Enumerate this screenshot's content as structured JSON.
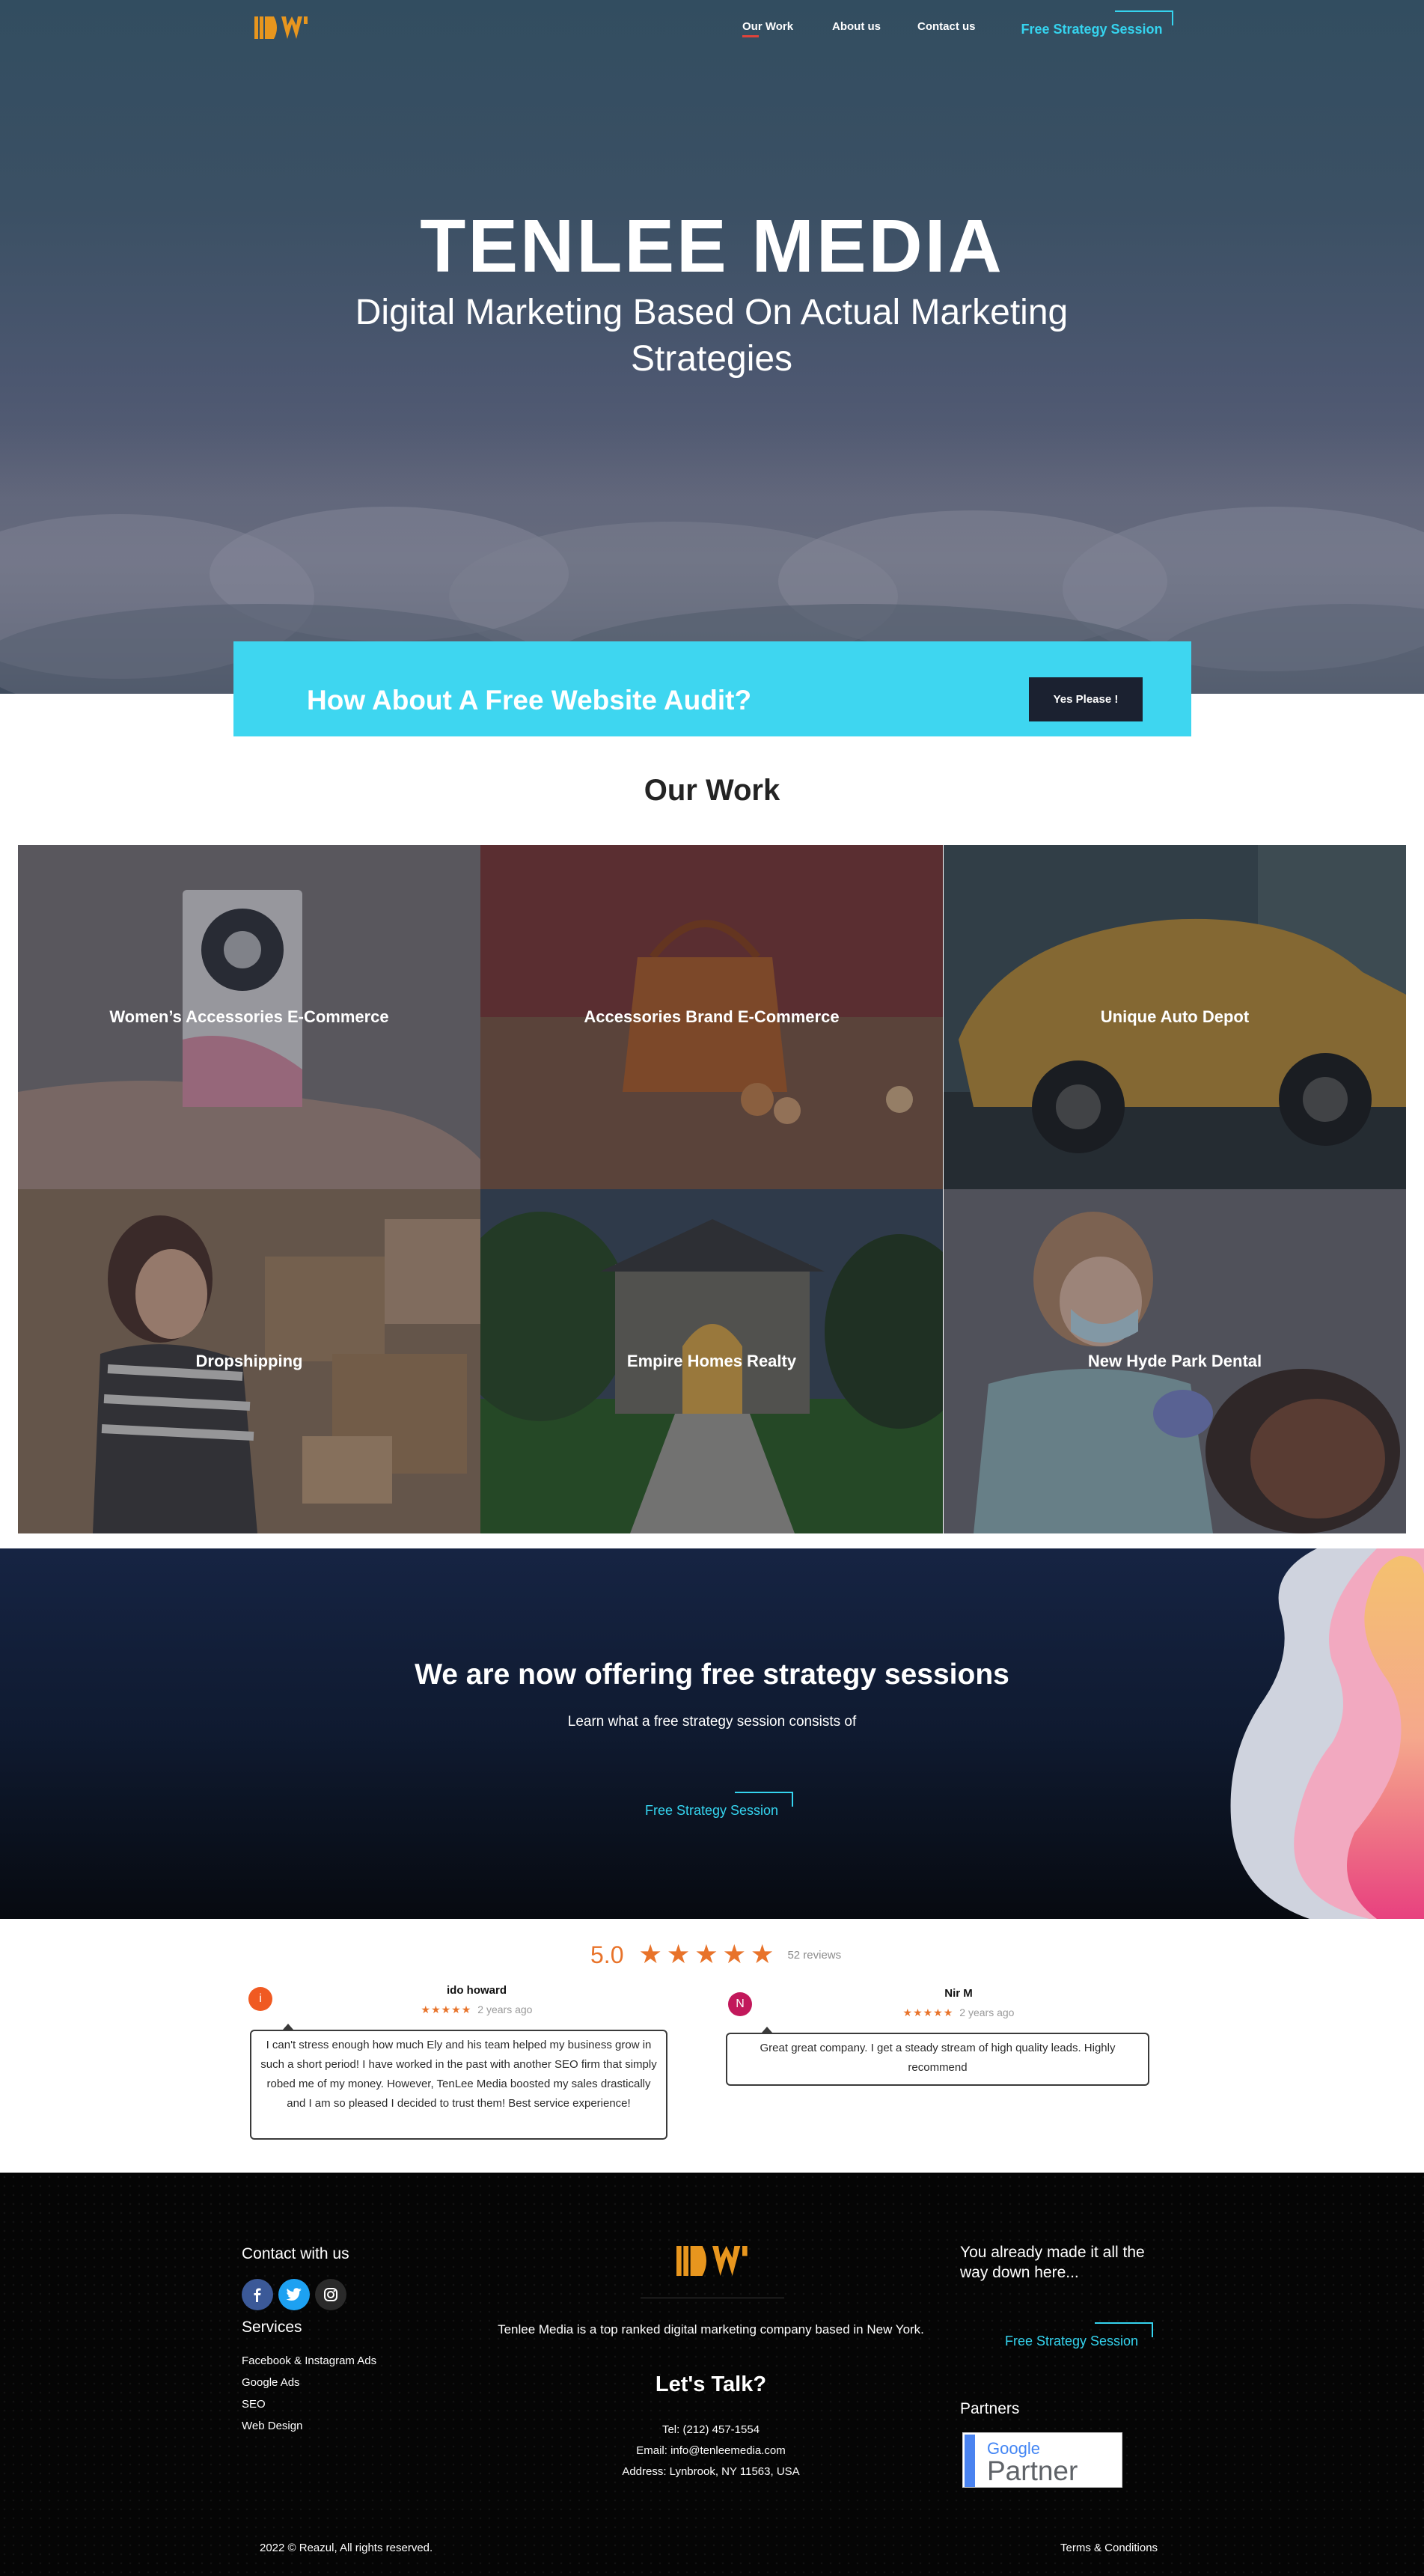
{
  "nav": {
    "links": [
      "Our Work",
      "About us",
      "Contact us"
    ],
    "cta": "Free Strategy Session"
  },
  "hero": {
    "title": "TENLEE MEDIA",
    "subtitle": "Digital Marketing Based On Actual Marketing Strategies"
  },
  "audit": {
    "title": "How About A Free Website Audit?",
    "button": "Yes Please !"
  },
  "work": {
    "title": "Our Work",
    "items": [
      "Women’s Accessories E-Commerce",
      "Accessories Brand E-Commerce",
      "Unique Auto Depot",
      "Dropshipping",
      "Empire Homes Realty",
      "New Hyde Park Dental"
    ]
  },
  "strategy": {
    "title": "We are now offering free strategy sessions",
    "subtitle": "Learn what a free strategy session consists of",
    "cta": "Free Strategy Session"
  },
  "reviews": {
    "score": "5.0",
    "stars": "★",
    "star_glyphs": "★★★★★",
    "count": "52 reviews",
    "items": [
      {
        "initial": "i",
        "avatar_color": "#f05a22",
        "name": "ido howard",
        "date": "2 years ago",
        "text": "I can't stress enough how much Ely and his team helped my business grow in such a short period! I have worked in the past with another SEO firm that simply robed me of my money. However, TenLee Media boosted my sales drastically and I am so pleased I decided to trust them! Best service experience!"
      },
      {
        "initial": "N",
        "avatar_color": "#c2185b",
        "name": "Nir M",
        "date": "2 years ago",
        "text": "Great great company. I get a steady stream of high quality leads. Highly recommend"
      }
    ]
  },
  "footer": {
    "contact_heading": "Contact with us",
    "services_heading": "Services",
    "services": [
      "Facebook & Instagram Ads",
      "Google Ads",
      "SEO",
      "Web Design"
    ],
    "about": "Tenlee Media is a top ranked digital marketing company based in New York.",
    "talk_heading": "Let's Talk?",
    "phone": "Tel: (212) 457-1554",
    "email": "Email: info@tenleemedia.com",
    "address": "Address: Lynbrook, NY 11563, USA",
    "cta_heading": "You already made it all the way down here...",
    "cta": "Free Strategy Session",
    "partners_heading": "Partners",
    "partner_badge": {
      "google": "Google",
      "partner": "Partner"
    },
    "copyright": "2022 © Reazul, All rights reserved.",
    "terms": "Terms & Conditions"
  },
  "colors": {
    "accent_cyan": "#35d4ef",
    "audit_bg": "#3ed6f0",
    "star_orange": "#e8732a",
    "logo_orange": "#e8961e"
  }
}
